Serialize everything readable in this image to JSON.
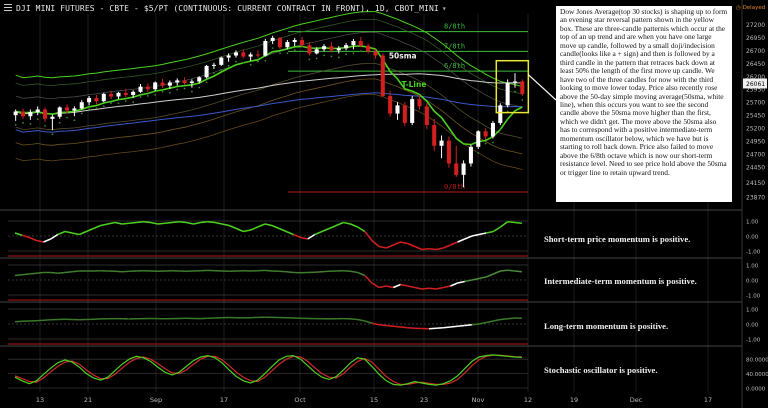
{
  "title": "DJI MINI FUTURES - CBTE - $5/PT (CONTINUOUS: CURRENT CONTRACT IN FRONT), 1D, CBOT_MINI",
  "delayed_label": "Delayed",
  "annotation": "Dow Jones Average(top 30 stocks) is shaping up to form an evening star reversal pattern shown in the yellow box. These are three-candle patternis which occur at the top of an up trend and are when you have one large move up candle, followed by a small doji/indecision candle(looks like a + sign) and then is followed by a third candle in the pattern that retraces back down at least 50% the length of the first move up candle. We have two of the three candles for now with the third looking to move lower today. Price also recently rose above the 50-day simple moving average(50sma, white line), when this occurs you want to see the second candle above the 50sma move higher than the first, which we didn't get. The move above the 50sma also has to correspond with a positive intermediate-term momentum oscillator below, which we have but is starting to roll back down. Price also failed to move above the 6/8th octave which is now our short-term resistance level. Need to see price hold above the 50sma or trigger line to retain upward trend.",
  "panel_labels": {
    "short": "Short-term price momentum is positive.",
    "intermediate": "Intermediate-term momentum  is positive.",
    "long": "Long-term momentum is positive.",
    "stochastic": "Stochastic oscillator is positive."
  },
  "colors": {
    "up": "#ffffff",
    "down": "#d41f1f",
    "green": "#4cd11f",
    "sma50": "#cfcfcf",
    "blue": "#3a58c8",
    "octave_green": "#3dbe3d",
    "octave_red": "#c01a1a"
  },
  "chart_data": {
    "type": "candlestick",
    "main": {
      "ylim": [
        23700,
        27400
      ],
      "y_ticks": [
        "27200",
        "26950",
        "26700",
        "26450",
        "26200",
        "25950",
        "25700",
        "25450",
        "25200",
        "24950",
        "24700",
        "24450",
        "24150",
        "23870"
      ],
      "last_price": "26061",
      "x_ticks": [
        "13",
        "21",
        "Sep",
        "17",
        "Oct",
        "15",
        "23",
        "Nov",
        "12",
        "19",
        "Dec",
        "17"
      ],
      "octaves": [
        {
          "label": "8/8th",
          "value": 27060
        },
        {
          "label": "7/8th",
          "value": 26680
        },
        {
          "label": "6/8th",
          "value": 26300
        },
        {
          "label": "0/8th",
          "value": 23970
        }
      ],
      "line_labels": [
        "50sma",
        "T-Line"
      ],
      "candles": [
        {
          "o": 25450,
          "h": 25560,
          "l": 25340,
          "c": 25520
        },
        {
          "o": 25520,
          "h": 25580,
          "l": 25380,
          "c": 25430
        },
        {
          "o": 25430,
          "h": 25560,
          "l": 25360,
          "c": 25510
        },
        {
          "o": 25510,
          "h": 25620,
          "l": 25450,
          "c": 25560
        },
        {
          "o": 25560,
          "h": 25600,
          "l": 25320,
          "c": 25380
        },
        {
          "o": 25380,
          "h": 25460,
          "l": 25160,
          "c": 25420
        },
        {
          "o": 25420,
          "h": 25620,
          "l": 25380,
          "c": 25600
        },
        {
          "o": 25600,
          "h": 25660,
          "l": 25480,
          "c": 25540
        },
        {
          "o": 25540,
          "h": 25620,
          "l": 25430,
          "c": 25580
        },
        {
          "o": 25580,
          "h": 25740,
          "l": 25560,
          "c": 25700
        },
        {
          "o": 25700,
          "h": 25820,
          "l": 25640,
          "c": 25780
        },
        {
          "o": 25780,
          "h": 25840,
          "l": 25660,
          "c": 25720
        },
        {
          "o": 25720,
          "h": 25880,
          "l": 25700,
          "c": 25860
        },
        {
          "o": 25860,
          "h": 25920,
          "l": 25760,
          "c": 25810
        },
        {
          "o": 25810,
          "h": 25900,
          "l": 25760,
          "c": 25880
        },
        {
          "o": 25880,
          "h": 25960,
          "l": 25800,
          "c": 25840
        },
        {
          "o": 25840,
          "h": 25930,
          "l": 25780,
          "c": 25900
        },
        {
          "o": 25900,
          "h": 26050,
          "l": 25880,
          "c": 26000
        },
        {
          "o": 26000,
          "h": 26060,
          "l": 25900,
          "c": 25950
        },
        {
          "o": 25950,
          "h": 26100,
          "l": 25920,
          "c": 26080
        },
        {
          "o": 26080,
          "h": 26150,
          "l": 25980,
          "c": 26020
        },
        {
          "o": 26020,
          "h": 26120,
          "l": 25960,
          "c": 26080
        },
        {
          "o": 26080,
          "h": 26160,
          "l": 26020,
          "c": 26120
        },
        {
          "o": 26120,
          "h": 26180,
          "l": 26040,
          "c": 26070
        },
        {
          "o": 26070,
          "h": 26140,
          "l": 25980,
          "c": 26100
        },
        {
          "o": 26100,
          "h": 26200,
          "l": 26060,
          "c": 26180
        },
        {
          "o": 26180,
          "h": 26420,
          "l": 26160,
          "c": 26400
        },
        {
          "o": 26400,
          "h": 26460,
          "l": 26340,
          "c": 26420
        },
        {
          "o": 26420,
          "h": 26580,
          "l": 26400,
          "c": 26560
        },
        {
          "o": 26560,
          "h": 26640,
          "l": 26480,
          "c": 26600
        },
        {
          "o": 26600,
          "h": 26700,
          "l": 26560,
          "c": 26660
        },
        {
          "o": 26660,
          "h": 26720,
          "l": 26540,
          "c": 26580
        },
        {
          "o": 26580,
          "h": 26660,
          "l": 26500,
          "c": 26620
        },
        {
          "o": 26620,
          "h": 26700,
          "l": 26560,
          "c": 26600
        },
        {
          "o": 26600,
          "h": 26920,
          "l": 26580,
          "c": 26880
        },
        {
          "o": 26880,
          "h": 26980,
          "l": 26820,
          "c": 26940
        },
        {
          "o": 26940,
          "h": 26960,
          "l": 26720,
          "c": 26760
        },
        {
          "o": 26760,
          "h": 26900,
          "l": 26720,
          "c": 26860
        },
        {
          "o": 26860,
          "h": 26940,
          "l": 26780,
          "c": 26900
        },
        {
          "o": 26900,
          "h": 26960,
          "l": 26760,
          "c": 26800
        },
        {
          "o": 26800,
          "h": 26860,
          "l": 26600,
          "c": 26640
        },
        {
          "o": 26640,
          "h": 26760,
          "l": 26620,
          "c": 26720
        },
        {
          "o": 26720,
          "h": 26820,
          "l": 26680,
          "c": 26780
        },
        {
          "o": 26780,
          "h": 26860,
          "l": 26660,
          "c": 26700
        },
        {
          "o": 26700,
          "h": 26780,
          "l": 26640,
          "c": 26740
        },
        {
          "o": 26740,
          "h": 26840,
          "l": 26700,
          "c": 26800
        },
        {
          "o": 26800,
          "h": 26920,
          "l": 26720,
          "c": 26880
        },
        {
          "o": 26880,
          "h": 26960,
          "l": 26760,
          "c": 26790
        },
        {
          "o": 26790,
          "h": 26830,
          "l": 26640,
          "c": 26680
        },
        {
          "o": 26680,
          "h": 26720,
          "l": 26540,
          "c": 26600
        },
        {
          "o": 26600,
          "h": 26640,
          "l": 25800,
          "c": 25820
        },
        {
          "o": 25820,
          "h": 25920,
          "l": 25420,
          "c": 25480
        },
        {
          "o": 25480,
          "h": 25700,
          "l": 25360,
          "c": 25640
        },
        {
          "o": 25640,
          "h": 25700,
          "l": 25240,
          "c": 25300
        },
        {
          "o": 25300,
          "h": 25820,
          "l": 25260,
          "c": 25760
        },
        {
          "o": 25760,
          "h": 25840,
          "l": 25560,
          "c": 25620
        },
        {
          "o": 25620,
          "h": 25680,
          "l": 25180,
          "c": 25260
        },
        {
          "o": 25260,
          "h": 25380,
          "l": 24760,
          "c": 24860
        },
        {
          "o": 24860,
          "h": 25060,
          "l": 24620,
          "c": 24960
        },
        {
          "o": 24960,
          "h": 25040,
          "l": 24440,
          "c": 24520
        },
        {
          "o": 24520,
          "h": 24860,
          "l": 24260,
          "c": 24300
        },
        {
          "o": 24300,
          "h": 24580,
          "l": 24060,
          "c": 24520
        },
        {
          "o": 24520,
          "h": 24880,
          "l": 24460,
          "c": 24840
        },
        {
          "o": 24840,
          "h": 25160,
          "l": 24800,
          "c": 25140
        },
        {
          "o": 25140,
          "h": 25200,
          "l": 24980,
          "c": 25040
        },
        {
          "o": 25040,
          "h": 25340,
          "l": 25000,
          "c": 25300
        },
        {
          "o": 25300,
          "h": 25680,
          "l": 25260,
          "c": 25640
        },
        {
          "o": 25640,
          "h": 26140,
          "l": 25600,
          "c": 26080
        },
        {
          "o": 26080,
          "h": 26260,
          "l": 25980,
          "c": 26100
        },
        {
          "o": 26100,
          "h": 26140,
          "l": 25820,
          "c": 25860
        }
      ]
    },
    "oscillators": [
      {
        "name": "short",
        "ylim": [
          -1.2,
          1.2
        ],
        "y_ticks": [
          "1.00",
          "0.00",
          "-1.00"
        ],
        "values": [
          0.2,
          0.05,
          -0.1,
          -0.3,
          -0.4,
          -0.2,
          0.1,
          0.3,
          0.2,
          0.1,
          0.3,
          0.5,
          0.7,
          0.8,
          0.9,
          0.8,
          0.85,
          0.9,
          0.95,
          0.9,
          0.8,
          0.85,
          0.9,
          0.95,
          0.9,
          0.8,
          0.9,
          0.95,
          0.9,
          0.8,
          0.7,
          0.5,
          0.3,
          0.4,
          0.6,
          0.8,
          0.7,
          0.5,
          0.3,
          0.1,
          -0.1,
          -0.2,
          0.1,
          0.3,
          0.5,
          0.7,
          0.9,
          0.8,
          0.6,
          0.3,
          -0.3,
          -0.7,
          -0.8,
          -0.6,
          -0.4,
          -0.5,
          -0.7,
          -0.9,
          -0.85,
          -0.9,
          -0.8,
          -0.6,
          -0.4,
          -0.2,
          0.0,
          0.1,
          0.2,
          0.3,
          0.6,
          0.95,
          0.9,
          0.85
        ]
      },
      {
        "name": "intermediate",
        "ylim": [
          -1.2,
          1.2
        ],
        "y_ticks": [
          "1.00",
          "0.00",
          "-1.00"
        ],
        "values": [
          0.3,
          0.35,
          0.4,
          0.45,
          0.5,
          0.5,
          0.45,
          0.5,
          0.55,
          0.6,
          0.6,
          0.6,
          0.62,
          0.6,
          0.58,
          0.55,
          0.58,
          0.6,
          0.62,
          0.6,
          0.58,
          0.6,
          0.62,
          0.6,
          0.58,
          0.6,
          0.62,
          0.64,
          0.62,
          0.6,
          0.58,
          0.6,
          0.62,
          0.6,
          0.62,
          0.64,
          0.6,
          0.58,
          0.55,
          0.5,
          0.48,
          0.5,
          0.52,
          0.55,
          0.58,
          0.6,
          0.62,
          0.58,
          0.5,
          0.3,
          -0.2,
          -0.5,
          -0.4,
          -0.5,
          -0.3,
          -0.4,
          -0.5,
          -0.6,
          -0.55,
          -0.6,
          -0.5,
          -0.4,
          -0.2,
          -0.1,
          0.0,
          0.1,
          0.2,
          0.4,
          0.6,
          0.65,
          0.6,
          0.55
        ]
      },
      {
        "name": "long",
        "ylim": [
          -1.2,
          1.2
        ],
        "y_ticks": [
          "1.00",
          "0.00",
          "-1.00"
        ],
        "values": [
          0.15,
          0.18,
          0.2,
          0.22,
          0.25,
          0.28,
          0.3,
          0.32,
          0.3,
          0.28,
          0.3,
          0.32,
          0.34,
          0.35,
          0.36,
          0.35,
          0.34,
          0.35,
          0.36,
          0.37,
          0.36,
          0.35,
          0.36,
          0.37,
          0.38,
          0.37,
          0.36,
          0.38,
          0.4,
          0.42,
          0.43,
          0.42,
          0.41,
          0.42,
          0.44,
          0.45,
          0.44,
          0.43,
          0.42,
          0.4,
          0.38,
          0.37,
          0.36,
          0.35,
          0.34,
          0.35,
          0.36,
          0.34,
          0.3,
          0.2,
          0.05,
          -0.05,
          -0.1,
          -0.15,
          -0.2,
          -0.25,
          -0.28,
          -0.3,
          -0.32,
          -0.28,
          -0.25,
          -0.2,
          -0.15,
          -0.1,
          -0.05,
          0.0,
          0.1,
          0.2,
          0.3,
          0.35,
          0.4,
          0.38
        ]
      },
      {
        "name": "stochastic",
        "ylim": [
          0,
          100
        ],
        "y_ticks": [
          "80.0000",
          "40.0000",
          "0.0000"
        ],
        "k": [
          30,
          20,
          12,
          20,
          38,
          55,
          70,
          78,
          72,
          58,
          40,
          28,
          22,
          30,
          48,
          66,
          80,
          88,
          84,
          74,
          58,
          44,
          36,
          44,
          60,
          76,
          86,
          90,
          84,
          70,
          50,
          32,
          20,
          14,
          22,
          40,
          60,
          78,
          88,
          90,
          80,
          62,
          44,
          30,
          24,
          32,
          50,
          70,
          84,
          80,
          60,
          38,
          20,
          10,
          8,
          12,
          18,
          14,
          10,
          8,
          12,
          20,
          34,
          54,
          74,
          86,
          90,
          92,
          90,
          88,
          86,
          85
        ],
        "d": [
          34,
          26,
          18,
          16,
          28,
          45,
          60,
          72,
          75,
          66,
          50,
          36,
          26,
          26,
          38,
          55,
          71,
          82,
          86,
          80,
          68,
          54,
          42,
          40,
          50,
          66,
          80,
          88,
          88,
          78,
          62,
          44,
          30,
          20,
          18,
          30,
          48,
          66,
          80,
          88,
          86,
          74,
          56,
          40,
          30,
          28,
          40,
          58,
          74,
          82,
          72,
          52,
          32,
          18,
          10,
          10,
          14,
          16,
          13,
          10,
          10,
          14,
          24,
          42,
          62,
          78,
          88,
          91,
          91,
          89,
          87,
          86
        ]
      }
    ]
  }
}
